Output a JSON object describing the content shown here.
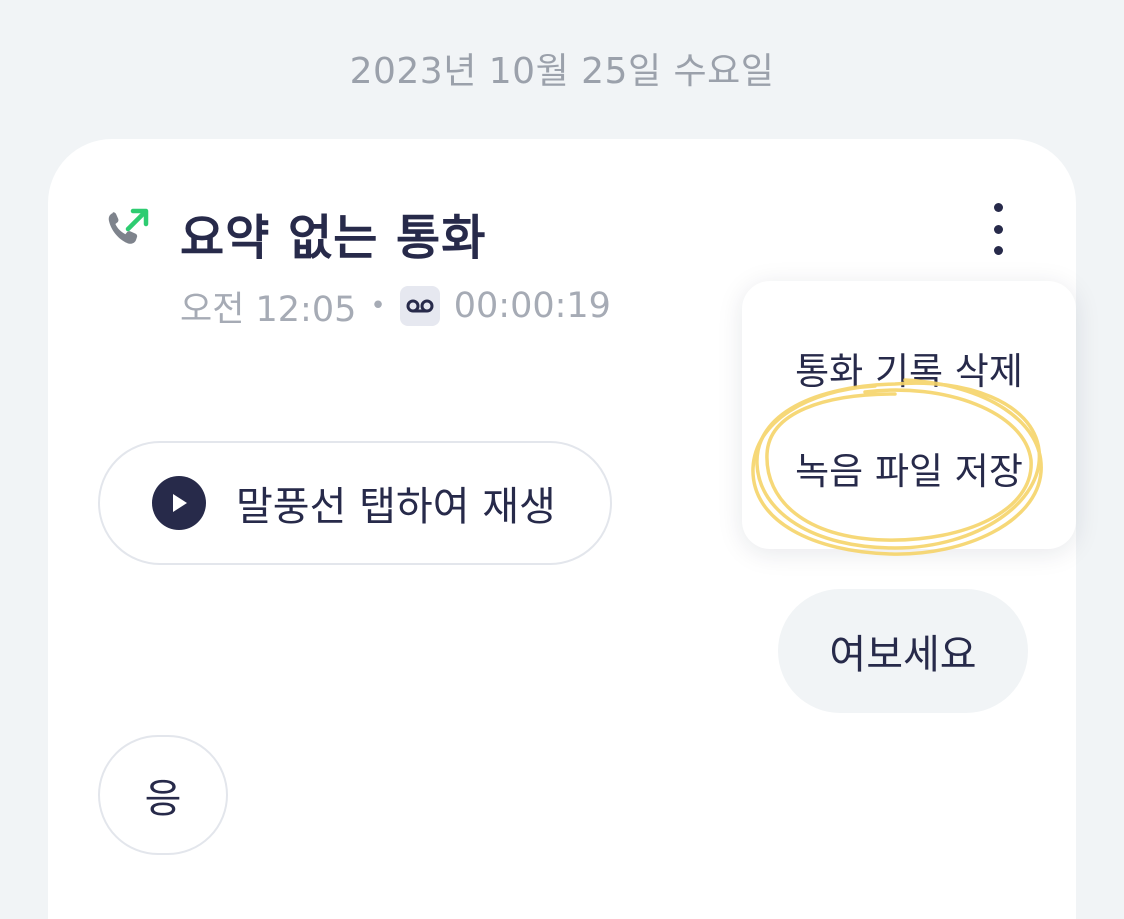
{
  "date_header": "2023년 10월 25일 수요일",
  "call": {
    "icon": "outgoing-call-icon",
    "title": "요약 없는 통화",
    "time": "오전 12:05",
    "separator": "•",
    "recording_icon": "voicemail-icon",
    "duration": "00:00:19"
  },
  "more_menu": {
    "icon": "more-vertical-icon",
    "items": [
      {
        "label": "통화 기록 삭제"
      },
      {
        "label": "녹음 파일 저장"
      }
    ]
  },
  "playback": {
    "icon": "play-icon",
    "label": "말풍선 탭하여 재생"
  },
  "transcript": [
    {
      "speaker": "me",
      "text": "여보세요"
    },
    {
      "speaker": "other",
      "text": "응"
    }
  ],
  "colors": {
    "background": "#f1f4f6",
    "text_primary": "#272a4a",
    "text_secondary": "#a6abb5",
    "accent_green": "#2ecc71",
    "annotation_yellow": "#f6d46a"
  }
}
